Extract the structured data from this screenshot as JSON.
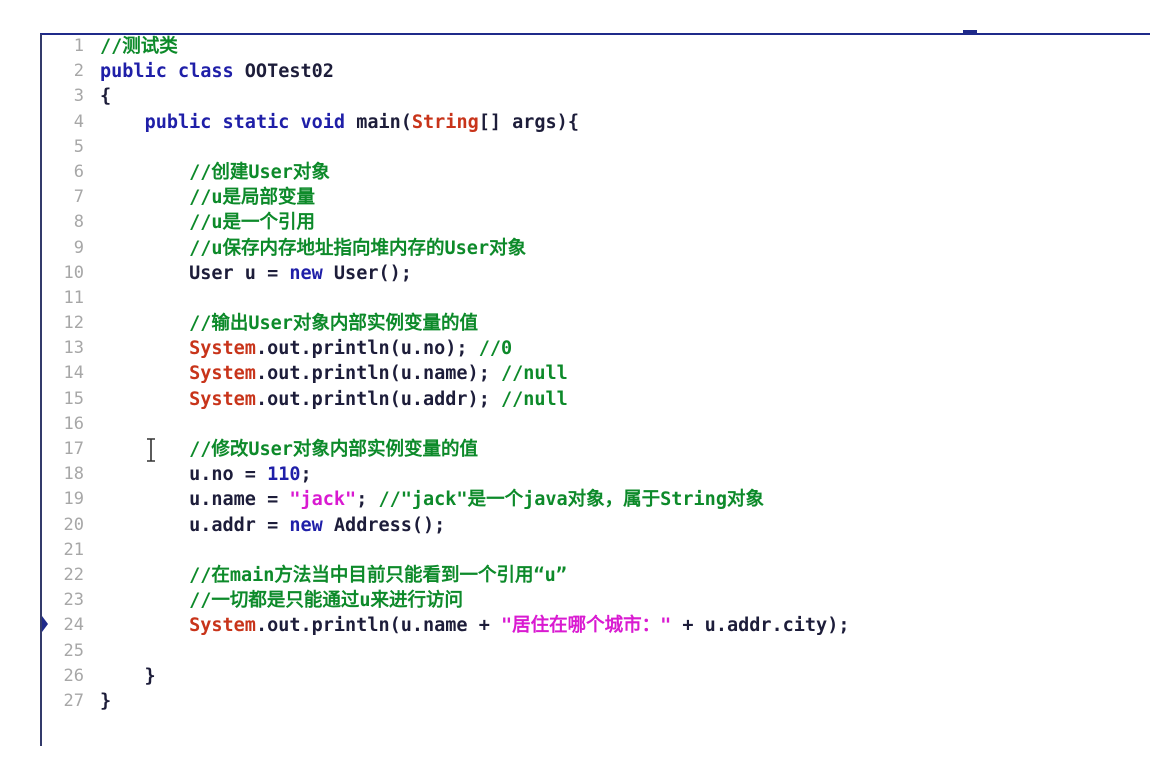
{
  "editor": {
    "lines": [
      {
        "n": "1",
        "t": [
          {
            "c": "cm",
            "v": "//测试类"
          }
        ]
      },
      {
        "n": "2",
        "t": [
          {
            "c": "kw",
            "v": "public class "
          },
          {
            "c": "",
            "v": "OOTest02"
          }
        ]
      },
      {
        "n": "3",
        "t": [
          {
            "c": "",
            "v": "{"
          }
        ]
      },
      {
        "n": "4",
        "t": [
          {
            "c": "",
            "v": "    "
          },
          {
            "c": "kw",
            "v": "public static void "
          },
          {
            "c": "",
            "v": "main("
          },
          {
            "c": "typ",
            "v": "String"
          },
          {
            "c": "",
            "v": "[] args){"
          }
        ]
      },
      {
        "n": "5",
        "t": []
      },
      {
        "n": "6",
        "t": [
          {
            "c": "",
            "v": "        "
          },
          {
            "c": "cm",
            "v": "//创建User对象"
          }
        ]
      },
      {
        "n": "7",
        "t": [
          {
            "c": "",
            "v": "        "
          },
          {
            "c": "cm",
            "v": "//u是局部变量"
          }
        ]
      },
      {
        "n": "8",
        "t": [
          {
            "c": "",
            "v": "        "
          },
          {
            "c": "cm",
            "v": "//u是一个引用"
          }
        ]
      },
      {
        "n": "9",
        "t": [
          {
            "c": "",
            "v": "        "
          },
          {
            "c": "cm",
            "v": "//u保存内存地址指向堆内存的User对象"
          }
        ]
      },
      {
        "n": "10",
        "t": [
          {
            "c": "",
            "v": "        User u = "
          },
          {
            "c": "kw",
            "v": "new"
          },
          {
            "c": "",
            "v": " User();"
          }
        ]
      },
      {
        "n": "11",
        "t": []
      },
      {
        "n": "12",
        "t": [
          {
            "c": "",
            "v": "        "
          },
          {
            "c": "cm",
            "v": "//输出User对象内部实例变量的值"
          }
        ]
      },
      {
        "n": "13",
        "t": [
          {
            "c": "",
            "v": "        "
          },
          {
            "c": "typ",
            "v": "System"
          },
          {
            "c": "",
            "v": ".out.println(u.no); "
          },
          {
            "c": "cm",
            "v": "//0"
          }
        ]
      },
      {
        "n": "14",
        "t": [
          {
            "c": "",
            "v": "        "
          },
          {
            "c": "typ",
            "v": "System"
          },
          {
            "c": "",
            "v": ".out.println(u.name); "
          },
          {
            "c": "cm",
            "v": "//null"
          }
        ]
      },
      {
        "n": "15",
        "t": [
          {
            "c": "",
            "v": "        "
          },
          {
            "c": "typ",
            "v": "System"
          },
          {
            "c": "",
            "v": ".out.println(u.addr); "
          },
          {
            "c": "cm",
            "v": "//null"
          }
        ]
      },
      {
        "n": "16",
        "t": []
      },
      {
        "n": "17",
        "t": [
          {
            "c": "",
            "v": "        "
          },
          {
            "c": "cm",
            "v": "//修改User对象内部实例变量的值"
          }
        ]
      },
      {
        "n": "18",
        "t": [
          {
            "c": "",
            "v": "        u.no = "
          },
          {
            "c": "num",
            "v": "110"
          },
          {
            "c": "",
            "v": ";"
          }
        ]
      },
      {
        "n": "19",
        "t": [
          {
            "c": "",
            "v": "        u.name = "
          },
          {
            "c": "str",
            "v": "\"jack\""
          },
          {
            "c": "",
            "v": "; "
          },
          {
            "c": "cm",
            "v": "//\"jack\"是一个java对象，属于String对象"
          }
        ]
      },
      {
        "n": "20",
        "t": [
          {
            "c": "",
            "v": "        u.addr = "
          },
          {
            "c": "kw",
            "v": "new"
          },
          {
            "c": "",
            "v": " Address();"
          }
        ]
      },
      {
        "n": "21",
        "t": []
      },
      {
        "n": "22",
        "t": [
          {
            "c": "",
            "v": "        "
          },
          {
            "c": "cm",
            "v": "//在main方法当中目前只能看到一个引用“u”"
          }
        ]
      },
      {
        "n": "23",
        "t": [
          {
            "c": "",
            "v": "        "
          },
          {
            "c": "cm",
            "v": "//一切都是只能通过u来进行访问"
          }
        ]
      },
      {
        "n": "24",
        "t": [
          {
            "c": "",
            "v": "        "
          },
          {
            "c": "typ",
            "v": "System"
          },
          {
            "c": "",
            "v": ".out.println(u.name + "
          },
          {
            "c": "str",
            "v": "\"居住在哪个城市：\""
          },
          {
            "c": "",
            "v": " + u.addr.city);"
          }
        ],
        "current": true
      },
      {
        "n": "25",
        "t": []
      },
      {
        "n": "26",
        "t": [
          {
            "c": "",
            "v": "    }"
          }
        ]
      },
      {
        "n": "27",
        "t": [
          {
            "c": "",
            "v": "}"
          }
        ]
      }
    ],
    "colors": {
      "keyword": "#1f1fa8",
      "comment": "#0d8a2a",
      "type": "#c8341a",
      "string": "#d91ad1",
      "line_number": "#a7a7a7",
      "plain": "#1d1d3a"
    },
    "icons": {
      "current_line_marker": "execution-arrow-icon",
      "mouse_cursor": "text-cursor-icon"
    }
  }
}
